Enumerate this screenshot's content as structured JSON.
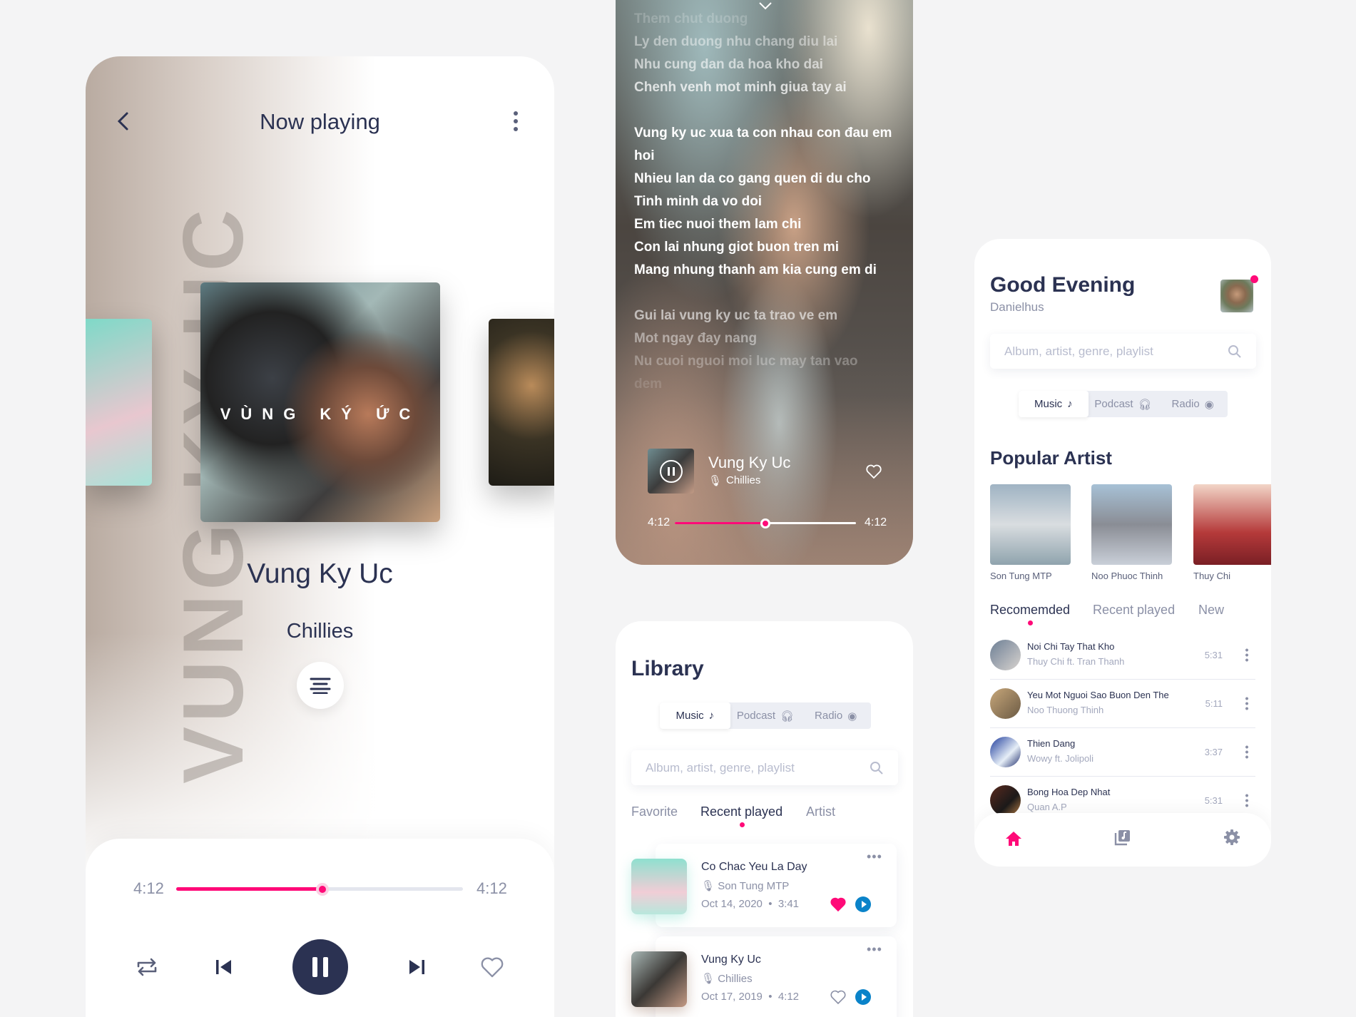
{
  "now_playing": {
    "header_title": "Now playing",
    "watermark": "VUNG KY UC",
    "album_art_text": "VÙNG KÝ ỨC",
    "song_title": "Vung Ky Uc",
    "artist": "Chillies",
    "elapsed": "4:12",
    "duration": "4:12",
    "progress": 0.51
  },
  "lyrics_view": {
    "lines": [
      "Them chut duong",
      "Ly den duong nhu chang diu lai",
      "Nhu cung dan da hoa kho dai",
      "Chenh venh mot minh giua tay ai",
      "",
      "Vung ky uc xua ta con nhau con đau em",
      "hoi",
      "Nhieu lan da co gang quen di du cho",
      "Tinh minh da vo doi",
      "Em tiec nuoi them lam chi",
      "Con lai nhung giot buon tren mi",
      "Mang nhung thanh am kia cung em di",
      "",
      "Gui lai vung ky uc ta trao ve em",
      "Mot ngay đay nang",
      "Nu cuoi nguoi moi luc may tan vao",
      "dem"
    ],
    "line_opacity": [
      0.2,
      0.45,
      0.6,
      0.75,
      1,
      1,
      1,
      1,
      1,
      1,
      1,
      1,
      1,
      0.6,
      0.45,
      0.3,
      0.15
    ],
    "mini_player": {
      "title": "Vung Ky Uc",
      "artist": "Chillies"
    },
    "elapsed": "4:12",
    "duration": "4:12",
    "progress": 0.5
  },
  "library": {
    "title": "Library",
    "segments": [
      "Music",
      "Podcast",
      "Radio"
    ],
    "search_placeholder": "Album, artist, genre, playlist",
    "tabs": [
      "Favorite",
      "Recent played",
      "Artist"
    ],
    "items": [
      {
        "title": "Co Chac Yeu La Day",
        "artist": "Son Tung MTP",
        "date": "Oct 14, 2020",
        "duration": "3:41",
        "liked": true
      },
      {
        "title": "Vung Ky Uc",
        "artist": "Chillies",
        "date": "Oct 17, 2019",
        "duration": "4:12",
        "liked": false
      }
    ]
  },
  "home": {
    "greeting": "Good Evening",
    "username": "Danielhus",
    "search_placeholder": "Album, artist, genre, playlist",
    "segments": [
      "Music",
      "Podcast",
      "Radio"
    ],
    "popular_title": "Popular Artist",
    "artists": [
      "Son Tung MTP",
      "Noo Phuoc Thinh",
      "Thuy Chi"
    ],
    "tabs": [
      "Recomemded",
      "Recent played",
      "New"
    ],
    "songs": [
      {
        "title": "Noi Chi Tay That Kho",
        "artist": "Thuy Chi ft. Tran Thanh",
        "duration": "5:31"
      },
      {
        "title": "Yeu Mot Nguoi Sao Buon Den The",
        "artist": "Noo Thuong Thinh",
        "duration": "5:11"
      },
      {
        "title": "Thien Dang",
        "artist": "Wowy ft. Jolipoli",
        "duration": "3:37"
      },
      {
        "title": "Bong Hoa Dep Nhat",
        "artist": "Quan A.P",
        "duration": "5:31"
      }
    ],
    "accent": "#ff0a78"
  }
}
